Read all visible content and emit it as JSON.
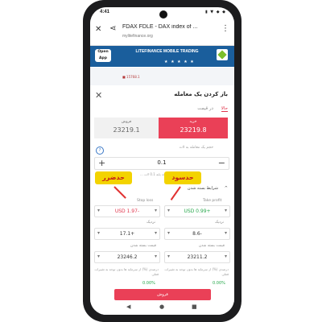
{
  "status_bar": {
    "time": "4:41",
    "icons": "▮ ▼ ◆ ◆"
  },
  "browser": {
    "close_icon": "close-icon",
    "share_icon": "share-icon",
    "title": "FDAX FDLE - DAX index of ...",
    "host": "mylitefinance.org",
    "menu_icon": "more-vert-icon"
  },
  "ad_banner": {
    "open_button": "Open App",
    "brand": "LITEFINANCE MOBILE TRADING",
    "stars": "★ ★ ★ ★ ★"
  },
  "chart_strip": {
    "tick": "■ 15768.1"
  },
  "dialog": {
    "title": "باز کردن یک معامله",
    "tab_now": "حالا",
    "tab_at_price": "در قیمت",
    "buy": {
      "label": "خرید",
      "value": "23219.8"
    },
    "sell": {
      "label": "فروش",
      "value": "23219.1"
    },
    "volume_label": "حجم یک معامله به لات",
    "volume_value": "0.1",
    "volume_hint": "... واحد پایه 0.1 لات",
    "conditions_label": "شرایط بسته شدن",
    "conditions_toggle": "^",
    "badge_loss": "حدضرر",
    "badge_profit": "حدسود",
    "stop_loss": {
      "label": "Stop loss",
      "value": "USD 1.97-"
    },
    "take_profit": {
      "label": "Take profit",
      "value": "USD 0.99+"
    },
    "points_label_left": "نزدیک",
    "points_label_right": "نزدیک",
    "sl_points": "17.1+",
    "tp_points": "8.6-",
    "price_label_left": "قیمت بسته شدن",
    "price_label_right": "قیمت بسته شدن",
    "sl_price": "23246.2",
    "tp_price": "23211.2",
    "sl_pct_note": "درصدی (%) از سرمایه ها بدون توجه به تغییرات فعلی",
    "tp_pct_note": "درصدی (%) از سرمایه ها بدون توجه به تغییرات فعلی",
    "sl_pct": "0.00%",
    "tp_pct": "0.00%",
    "submit": "فروش"
  },
  "nav": {
    "back": "◀",
    "home": "●",
    "recent": "■"
  },
  "colors": {
    "accent": "#ea4057",
    "badge": "#f3d300",
    "badge_text": "#c41a1a",
    "profit": "#29a84d",
    "loss": "#e0364d"
  }
}
